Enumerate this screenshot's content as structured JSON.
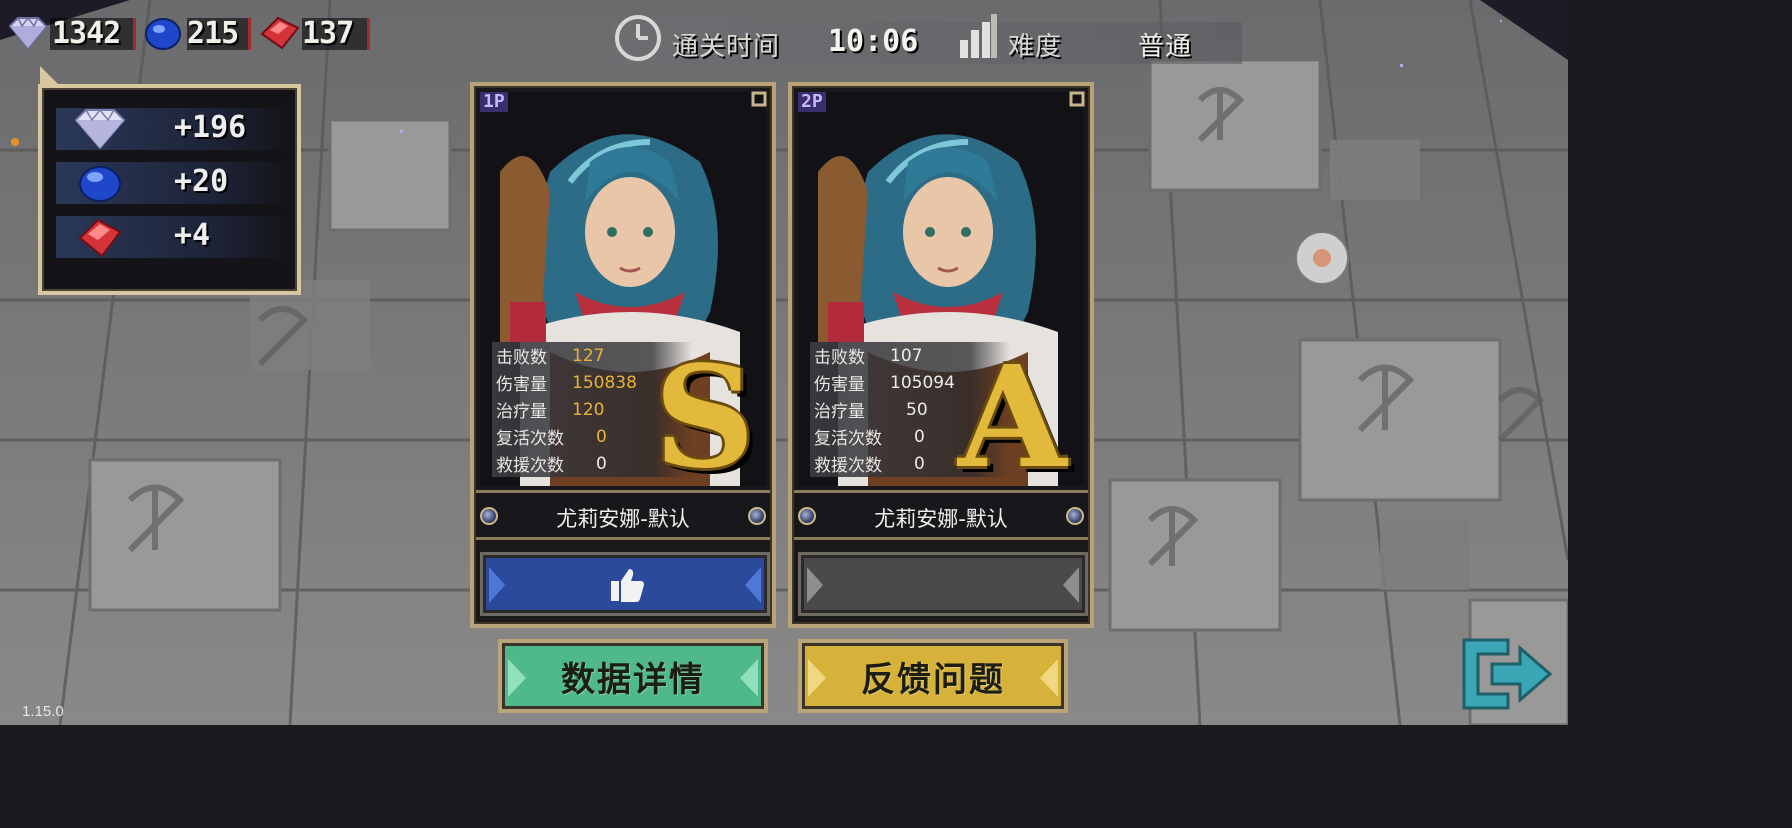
{
  "currencies": [
    {
      "icon": "diamond-icon",
      "value": "1342",
      "color": "#c9c8f0"
    },
    {
      "icon": "blue-gem-icon",
      "value": "215",
      "color": "#2b58d8"
    },
    {
      "icon": "red-gem-icon",
      "value": "137",
      "color": "#d83a3f"
    }
  ],
  "rewards": [
    {
      "icon": "diamond-icon",
      "value": "+196"
    },
    {
      "icon": "blue-gem-icon",
      "value": "+20"
    },
    {
      "icon": "red-gem-icon",
      "value": "+4"
    }
  ],
  "topbar": {
    "clear_time_label": "通关时间",
    "clear_time": "10:06",
    "difficulty_label": "难度",
    "difficulty_value": "普通"
  },
  "players": [
    {
      "tag": "1P",
      "grade": "S",
      "character": "尤莉安娜-默认",
      "liked": true,
      "stats": [
        {
          "label": "击败数",
          "value": "127"
        },
        {
          "label": "伤害量",
          "value": "150838"
        },
        {
          "label": "治疗量",
          "value": "120"
        },
        {
          "label": "复活次数",
          "value": "0"
        },
        {
          "label": "救援次数",
          "value": "0"
        }
      ],
      "stat_highlight_color": "#e8b23a"
    },
    {
      "tag": "2P",
      "grade": "A",
      "character": "尤莉安娜-默认",
      "liked": false,
      "stats": [
        {
          "label": "击败数",
          "value": "107"
        },
        {
          "label": "伤害量",
          "value": "105094"
        },
        {
          "label": "治疗量",
          "value": "50"
        },
        {
          "label": "复活次数",
          "value": "0"
        },
        {
          "label": "救援次数",
          "value": "0"
        }
      ],
      "stat_highlight_color": "#ecebe6"
    }
  ],
  "buttons": {
    "data_details": "数据详情",
    "feedback": "反馈问题"
  },
  "colors": {
    "grade_gold": "#e2b93a",
    "like_active": "#2b4a9c",
    "like_inactive": "#4a4a4c",
    "details_button": "#4fb98a",
    "feedback_button": "#d6b23a",
    "exit_icon": "#3aa6b6"
  },
  "version": "1.15.0"
}
